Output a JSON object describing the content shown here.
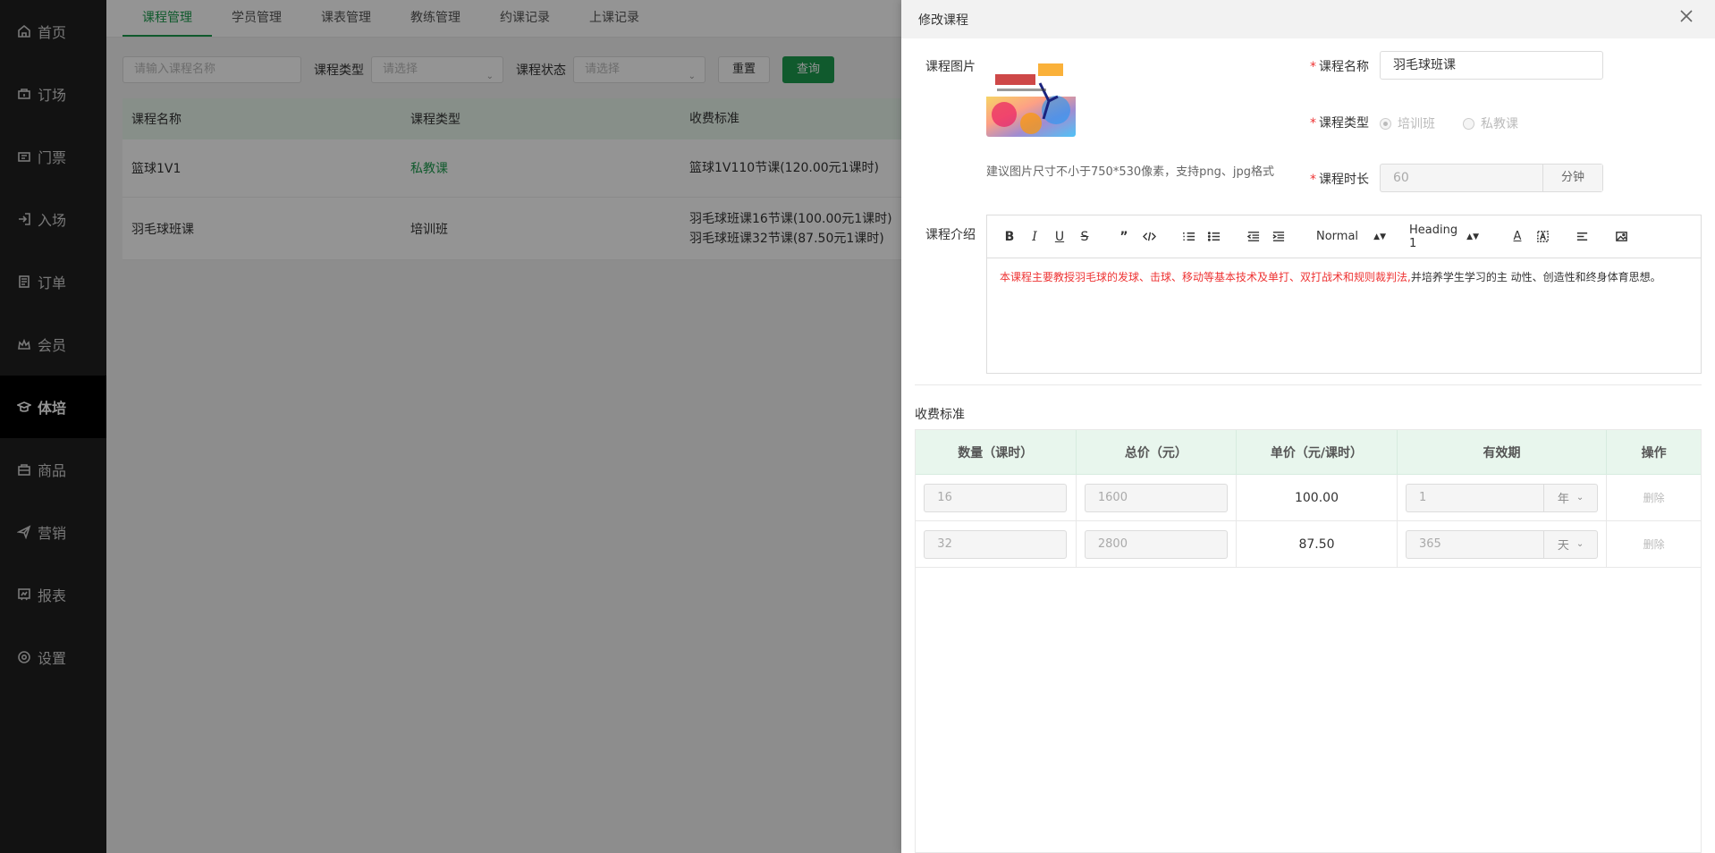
{
  "sidebar": {
    "items": [
      {
        "label": "首页",
        "icon": "home-icon"
      },
      {
        "label": "订场",
        "icon": "venue-icon"
      },
      {
        "label": "门票",
        "icon": "ticket-icon"
      },
      {
        "label": "入场",
        "icon": "entry-icon"
      },
      {
        "label": "订单",
        "icon": "order-icon"
      },
      {
        "label": "会员",
        "icon": "member-icon"
      },
      {
        "label": "体培",
        "icon": "training-icon",
        "active": true
      },
      {
        "label": "商品",
        "icon": "goods-icon"
      },
      {
        "label": "营销",
        "icon": "marketing-icon"
      },
      {
        "label": "报表",
        "icon": "report-icon"
      },
      {
        "label": "设置",
        "icon": "settings-icon"
      }
    ]
  },
  "tabs": [
    "课程管理",
    "学员管理",
    "课表管理",
    "教练管理",
    "约课记录",
    "上课记录"
  ],
  "filter": {
    "name_placeholder": "请输入课程名称",
    "type_label": "课程类型",
    "type_placeholder": "请选择",
    "status_label": "课程状态",
    "status_placeholder": "请选择",
    "reset_label": "重置",
    "query_label": "查询"
  },
  "bg_table": {
    "headers": [
      "课程名称",
      "课程类型",
      "收费标准"
    ],
    "rows": [
      {
        "name": "篮球1V1",
        "type": "私教课",
        "fee1": "篮球1V110节课(120.00元1课时)",
        "fee2": ""
      },
      {
        "name": "羽毛球班课",
        "type": "培训班",
        "fee1": "羽毛球班课16节课(100.00元1课时)",
        "fee2": "羽毛球班课32节课(87.50元1课时)"
      }
    ]
  },
  "drawer": {
    "title": "修改课程",
    "image_label": "课程图片",
    "image_hint": "建议图片尺寸不小于750*530像素，支持png、jpg格式",
    "name_label": "课程名称",
    "name_value": "羽毛球班课",
    "type_label": "课程类型",
    "type_options": [
      "培训班",
      "私教课"
    ],
    "duration_label": "课程时长",
    "duration_value": "60",
    "duration_unit": "分钟",
    "intro_label": "课程介绍",
    "editor": {
      "font_select": "Normal",
      "heading_select": "Heading 1",
      "content_red": "本课程主要教授羽毛球的发球、击球、移动等基本技术及单打、双打战术和规则裁判法,",
      "content_rest": "并培养学生学习的主 动性、创造性和终身体育思想。"
    },
    "fee_title": "收费标准",
    "fee_headers": [
      "数量（课时）",
      "总价（元）",
      "单价（元/课时）",
      "有效期",
      "操作"
    ],
    "fee_rows": [
      {
        "qty": "16",
        "total": "1600",
        "unit_price": "100.00",
        "period": "1",
        "period_unit": "年",
        "action": "删除"
      },
      {
        "qty": "32",
        "total": "2800",
        "unit_price": "87.50",
        "period": "365",
        "period_unit": "天",
        "action": "删除"
      }
    ]
  },
  "colors": {
    "accent": "#1d9b4f",
    "sidebar_bg": "#1f1f1f",
    "required": "#e33333"
  }
}
